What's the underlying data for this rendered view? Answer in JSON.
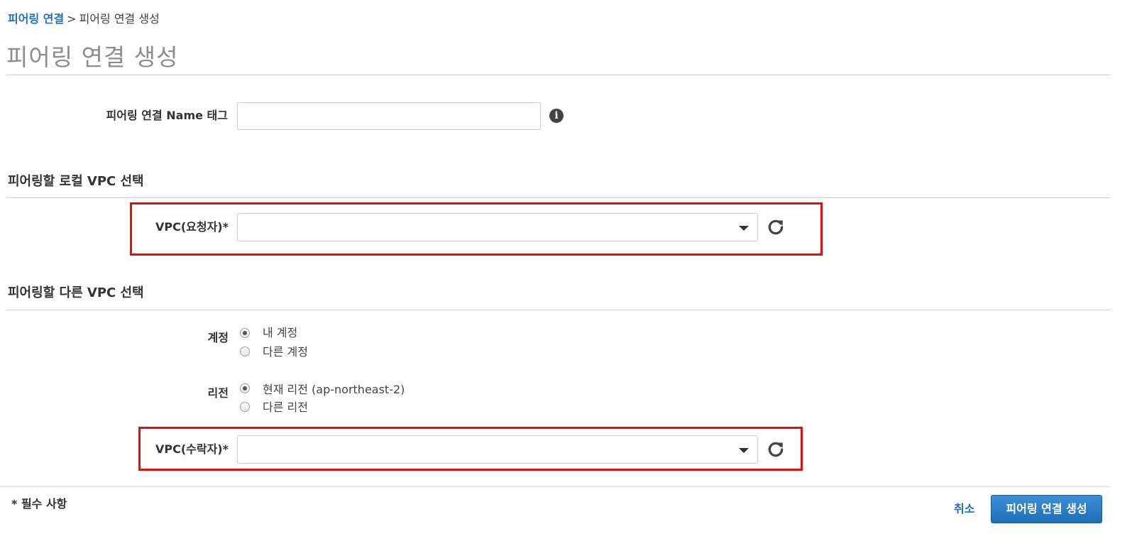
{
  "breadcrumb": {
    "parent": "피어링 연결",
    "separator": ">",
    "current": "피어링 연결 생성"
  },
  "page_title": "피어링 연결 생성",
  "name_tag": {
    "label": "피어링 연결 Name 태그",
    "value": "",
    "info_icon": "info-circle"
  },
  "local_section": {
    "heading": "피어링할 로컬 VPC 선택",
    "requester": {
      "label": "VPC(요청자)*",
      "value": "",
      "refresh_icon": "refresh"
    }
  },
  "other_section": {
    "heading": "피어링할 다른 VPC 선택",
    "account": {
      "label": "계정",
      "options": [
        "내 계정",
        "다른 계정"
      ],
      "selected": "내 계정"
    },
    "region": {
      "label": "리전",
      "options": [
        "현재 리전 (ap-northeast-2)",
        "다른 리전"
      ],
      "selected": "현재 리전 (ap-northeast-2)"
    },
    "accepter": {
      "label": "VPC(수락자)*",
      "value": "",
      "refresh_icon": "refresh"
    }
  },
  "footer": {
    "required_note": "* 필수 사항",
    "cancel_label": "취소",
    "submit_label": "피어링 연결 생성"
  },
  "colors": {
    "link": "#1f72c3",
    "primary_button": "#1c6eb7",
    "highlight": "#e01010",
    "title": "#8d8d8d"
  }
}
